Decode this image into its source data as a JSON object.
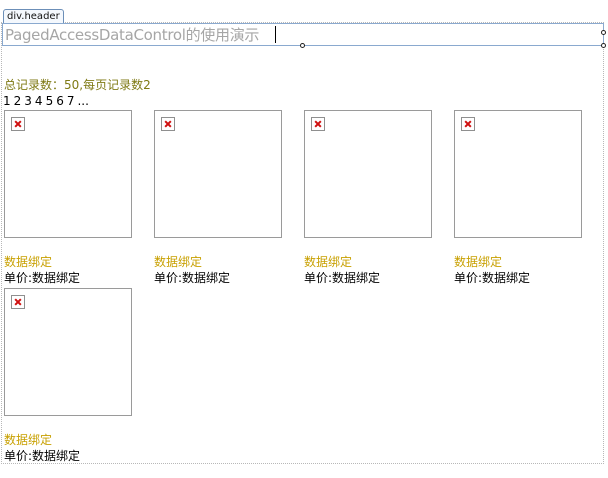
{
  "header": {
    "tag_label": "div.header",
    "title": "PagedAccessDataControl的使用演示"
  },
  "summary": "总记录数：50,每页记录数2",
  "pager": {
    "pages": [
      "1",
      "2",
      "3",
      "4",
      "5",
      "6",
      "7"
    ],
    "more": "..."
  },
  "items": [
    {
      "name": "数据绑定",
      "price": "单价:数据绑定"
    },
    {
      "name": "数据绑定",
      "price": "单价:数据绑定"
    },
    {
      "name": "数据绑定",
      "price": "单价:数据绑定"
    },
    {
      "name": "数据绑定",
      "price": "单价:数据绑定"
    },
    {
      "name": "数据绑定",
      "price": "单价:数据绑定"
    }
  ],
  "colors": {
    "summary": "#7f7a15",
    "item_name": "#c8a000",
    "header_title": "#a6a6a6",
    "header_border": "#8aa9cf"
  },
  "icons": {
    "item_image": "broken-image-icon"
  }
}
